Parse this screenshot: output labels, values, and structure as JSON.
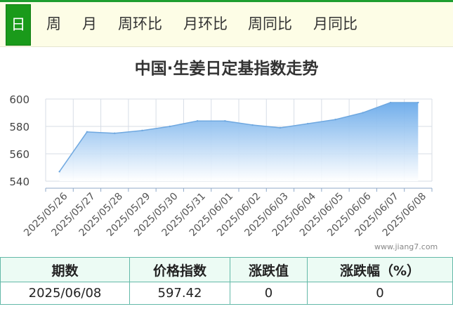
{
  "tabs": [
    {
      "label": "日",
      "active": true
    },
    {
      "label": "周",
      "active": false
    },
    {
      "label": "月",
      "active": false
    },
    {
      "label": "周环比",
      "active": false
    },
    {
      "label": "月环比",
      "active": false
    },
    {
      "label": "周同比",
      "active": false
    },
    {
      "label": "月同比",
      "active": false
    }
  ],
  "chart_title": "中国·生姜日定基指数走势",
  "watermark": "www.jiang7.com",
  "colors": {
    "tab_active_bg": "#1a9a1a",
    "line": "#6fa8e0",
    "fill_top": "#6aaaea",
    "fill_bottom": "#ffffff",
    "table_border": "#63b9a8"
  },
  "chart_data": {
    "type": "area",
    "title": "中国·生姜日定基指数走势",
    "xlabel": "",
    "ylabel": "",
    "ylim": [
      540,
      600
    ],
    "yticks": [
      540,
      560,
      580,
      600
    ],
    "grid": true,
    "categories": [
      "2025/05/26",
      "2025/05/27",
      "2025/05/28",
      "2025/05/29",
      "2025/05/30",
      "2025/05/31",
      "2025/06/01",
      "2025/06/02",
      "2025/06/03",
      "2025/06/04",
      "2025/06/05",
      "2025/06/06",
      "2025/06/07",
      "2025/06/08"
    ],
    "series": [
      {
        "values": [
          547,
          576,
          575,
          577,
          580,
          584,
          584,
          581,
          579,
          582,
          585,
          590,
          597.42,
          597.42
        ]
      }
    ]
  },
  "table": {
    "headers": [
      "期数",
      "价格指数",
      "涨跌值",
      "涨跌幅（%）"
    ],
    "row": [
      "2025/06/08",
      "597.42",
      "0",
      "0"
    ]
  }
}
